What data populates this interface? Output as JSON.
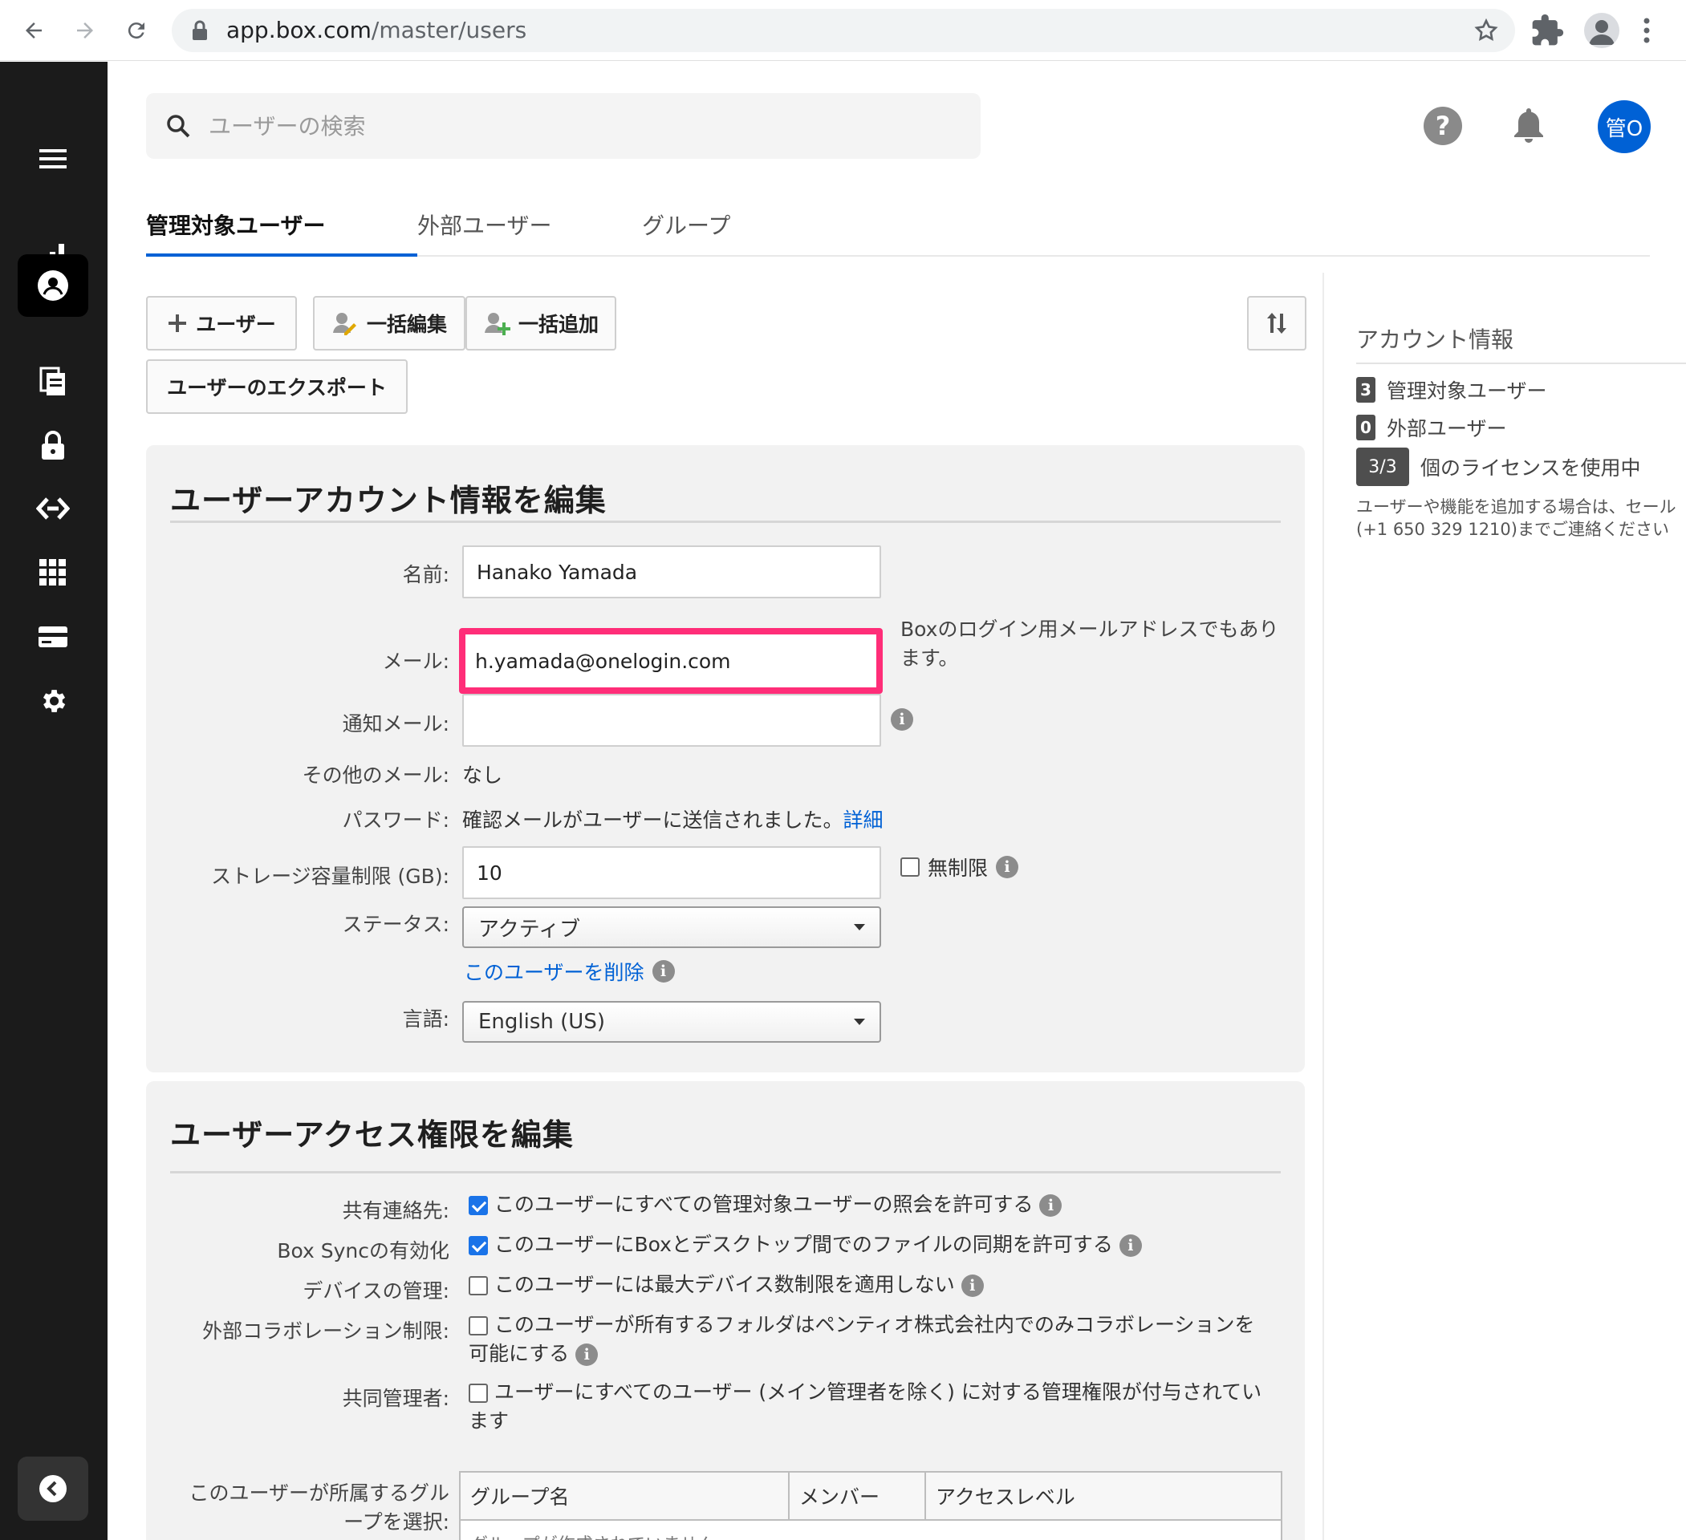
{
  "browser": {
    "url_host": "app.box.com",
    "url_path": "/master/users"
  },
  "search": {
    "placeholder": "ユーザーの検索"
  },
  "header": {
    "help": "?",
    "avatar": "管O"
  },
  "tabs": [
    {
      "label": "管理対象ユーザー",
      "active": true
    },
    {
      "label": "外部ユーザー",
      "active": false
    },
    {
      "label": "グループ",
      "active": false
    }
  ],
  "toolbar": {
    "add_user": "ユーザー",
    "bulk_edit": "一括編集",
    "bulk_add": "一括追加",
    "export": "ユーザーのエクスポート"
  },
  "account_panel": {
    "title": "アカウント情報",
    "managed_count": "3",
    "managed_label": "管理対象ユーザー",
    "external_count": "0",
    "external_label": "外部ユーザー",
    "license_count": "3/3",
    "license_label": "個のライセンスを使用中",
    "note_line1": "ユーザーや機能を追加する場合は、セール",
    "note_line2": "(+1 650 329 1210)までご連絡ください"
  },
  "edit_account": {
    "title": "ユーザーアカウント情報を編集",
    "name_label": "名前:",
    "name_value": "Hanako Yamada",
    "email_label": "メール:",
    "email_value": "h.yamada@onelogin.com",
    "email_note": "Boxのログイン用メールアドレスでもあります。",
    "notify_label": "通知メール:",
    "notify_value": "",
    "other_email_label": "その他のメール:",
    "other_email_value": "なし",
    "password_label": "パスワード:",
    "password_value": "確認メールがユーザーに送信されました。",
    "password_link": "詳細",
    "storage_label": "ストレージ容量制限 (GB):",
    "storage_value": "10",
    "unlimited_label": "無制限",
    "status_label": "ステータス:",
    "status_value": "アクティブ",
    "delete_link": "このユーザーを削除",
    "language_label": "言語:",
    "language_value": "English (US)"
  },
  "edit_access": {
    "title": "ユーザーアクセス権限を編集",
    "rows": [
      {
        "label": "共有連絡先:",
        "text": "このユーザーにすべての管理対象ユーザーの照会を許可する",
        "checked": true
      },
      {
        "label": "Box Syncの有効化",
        "text": "このユーザーにBoxとデスクトップ間でのファイルの同期を許可する",
        "checked": true
      },
      {
        "label": "デバイスの管理:",
        "text": "このユーザーには最大デバイス数制限を適用しない",
        "checked": false
      },
      {
        "label": "外部コラボレーション制限:",
        "text": "このユーザーが所有するフォルダはペンティオ株式会社内でのみコラボレーションを可能にする",
        "checked": false
      },
      {
        "label": "共同管理者:",
        "text": "ユーザーにすべてのユーザー (メイン管理者を除く) に対する管理権限が付与されています",
        "checked": false
      }
    ],
    "groups_label": "このユーザーが所属するグループを選択:",
    "groups_columns": [
      "グループ名",
      "メンバー",
      "アクセスレベル"
    ],
    "groups_empty": "グループが作成されていません"
  },
  "colors": {
    "accent": "#0061d5",
    "highlight": "#ff2d78",
    "sidebar": "#1b1b1b"
  },
  "icons": [
    "back-arrow-icon",
    "forward-arrow-icon",
    "reload-icon",
    "lock-icon",
    "star-icon",
    "puzzle-icon",
    "profile-icon",
    "kebab-icon",
    "hamburger-icon",
    "bar-chart-icon",
    "user-icon",
    "files-icon",
    "padlock-icon",
    "relay-icon",
    "apps-grid-icon",
    "billing-card-icon",
    "gear-icon",
    "search-icon",
    "bell-icon",
    "plus-icon",
    "sort-icon",
    "info-icon",
    "chevron-left-icon"
  ]
}
